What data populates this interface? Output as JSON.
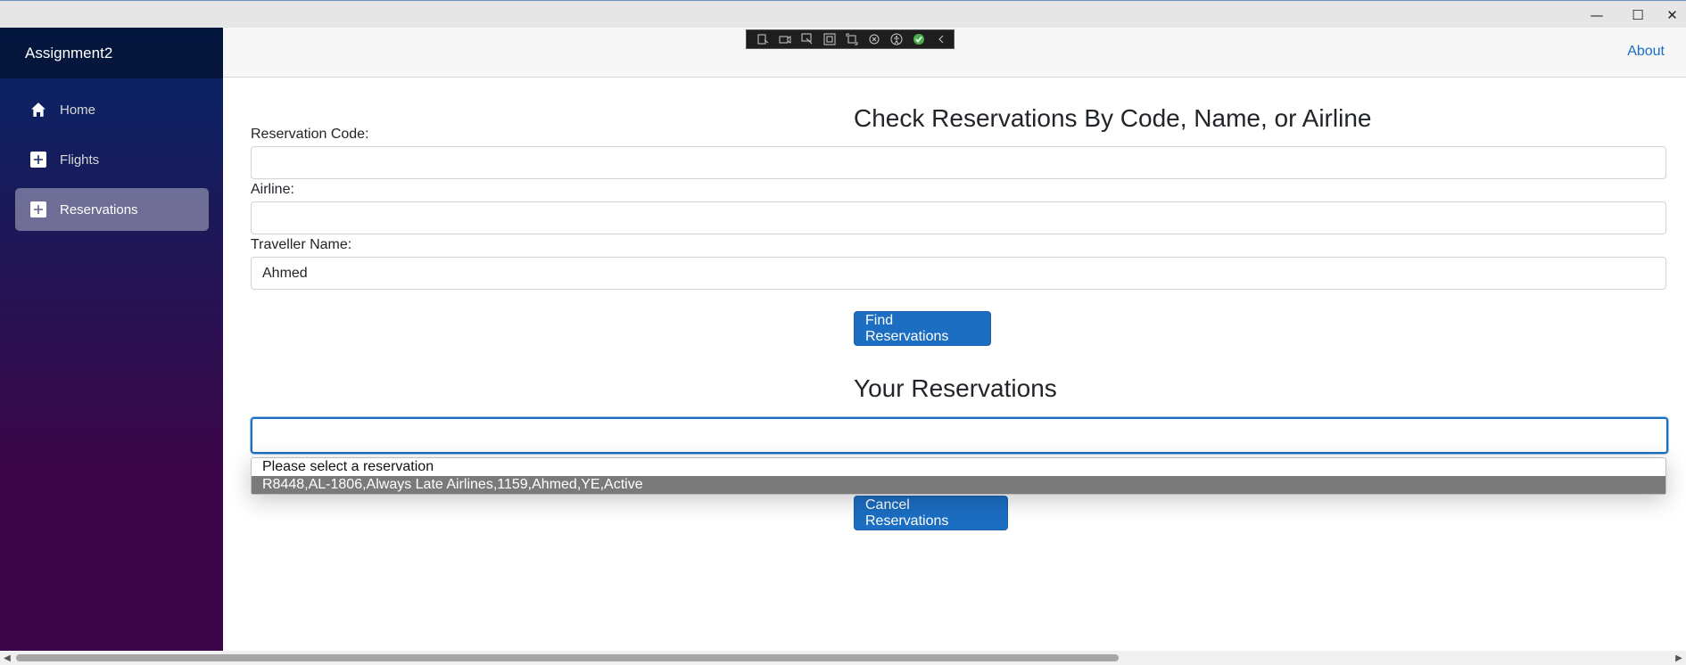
{
  "window": {
    "minimize": "—",
    "maximize": "☐",
    "close": "✕"
  },
  "app": {
    "brand": "Assignment2"
  },
  "sidebar": {
    "items": [
      {
        "label": "Home",
        "icon": "home-icon"
      },
      {
        "label": "Flights",
        "icon": "plus-icon"
      },
      {
        "label": "Reservations",
        "icon": "plus-icon",
        "active": true
      }
    ]
  },
  "header": {
    "about": "About"
  },
  "page": {
    "title": "Check Reservations By Code, Name, or Airline",
    "reservation_code_label": "Reservation Code:",
    "reservation_code_value": "",
    "airline_label": "Airline:",
    "airline_value": "",
    "traveller_name_label": "Traveller Name:",
    "traveller_name_value": "Ahmed",
    "find_button": "Find Reservations",
    "results_title": "Your Reservations",
    "reservations_dropdown": {
      "options": [
        "Please select a reservation",
        "R8448,AL-1806,Always Late Airlines,1159,Ahmed,YE,Active"
      ],
      "highlighted_index": 1
    },
    "cancel_button": "Cancel Reservations"
  },
  "colors": {
    "accent": "#1b6ec2",
    "sidebar_top": "#052767",
    "sidebar_bottom": "#3a0647"
  }
}
